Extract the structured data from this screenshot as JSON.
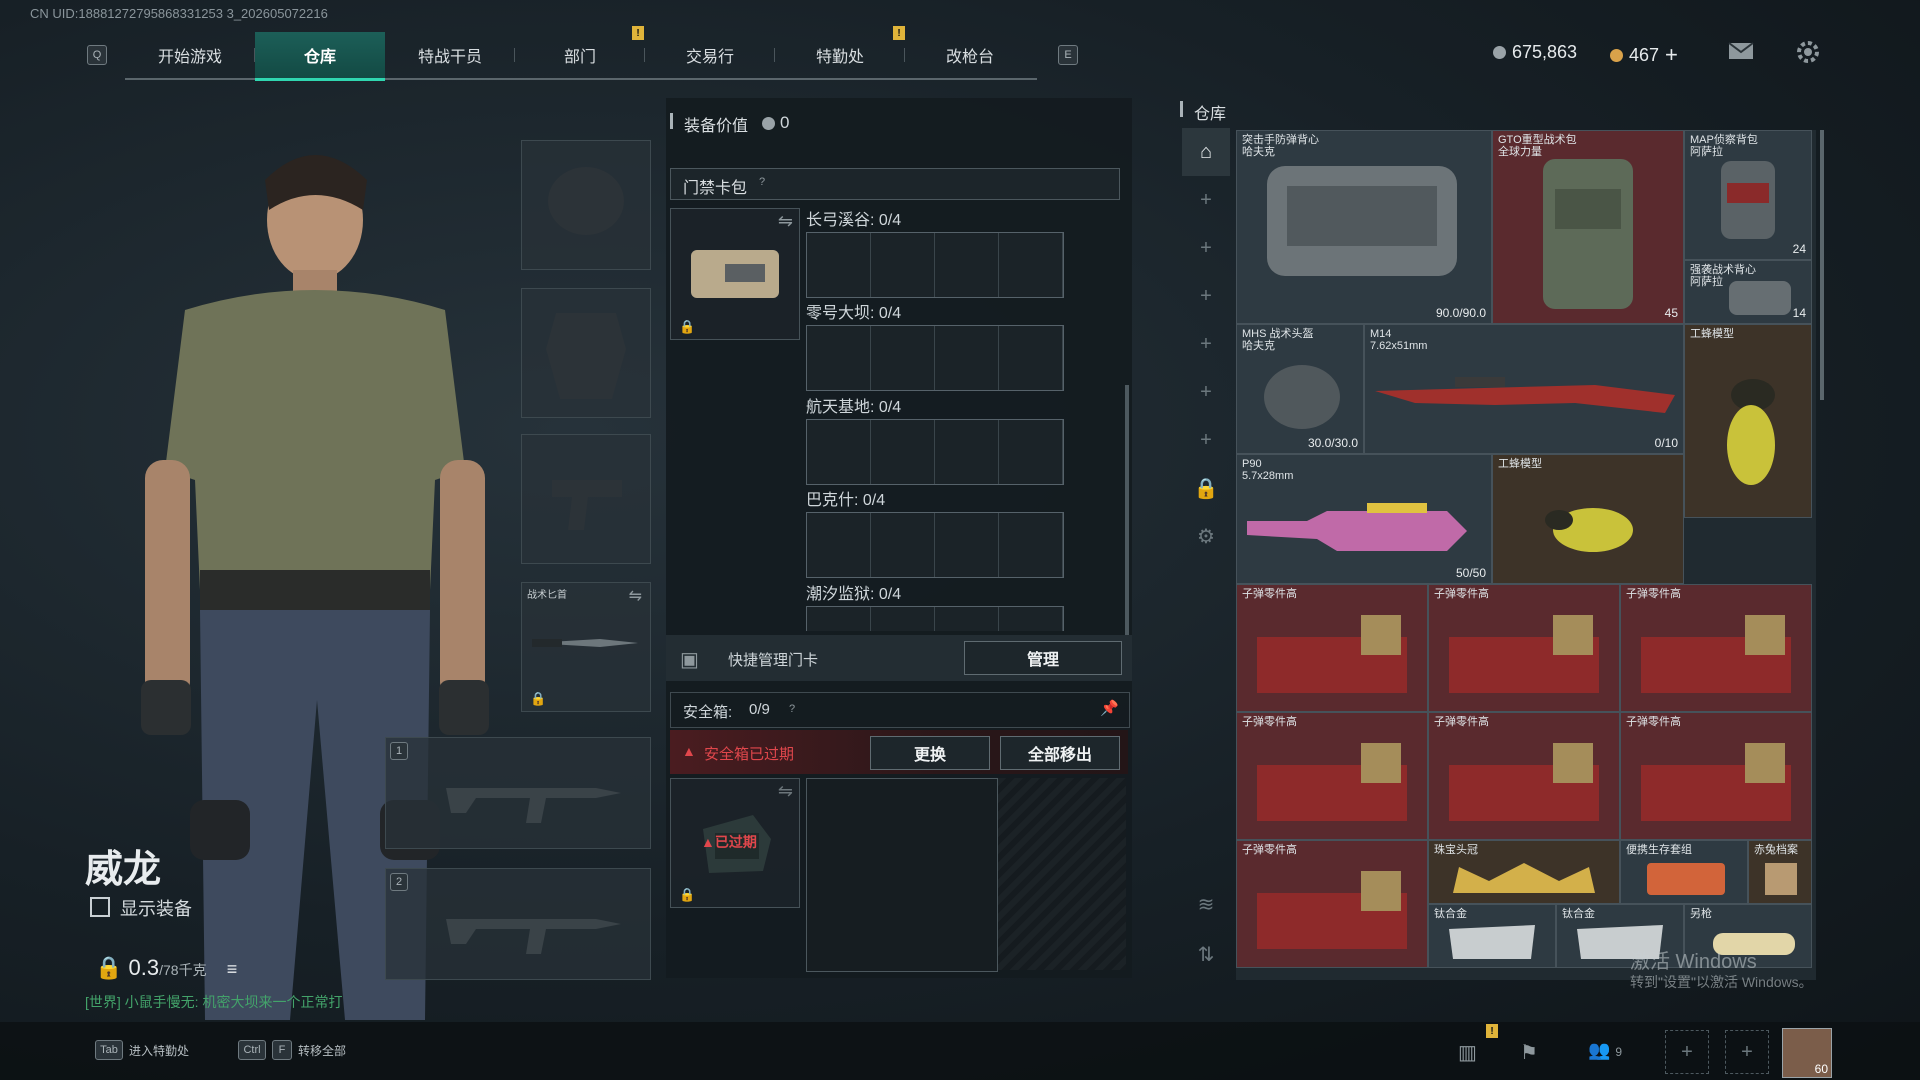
{
  "uid": "CN UID:18881272795868331253 3_202605072216",
  "nav": {
    "left_key": "Q",
    "right_key": "E",
    "tabs": [
      "开始游戏",
      "仓库",
      "特战干员",
      "部门",
      "交易行",
      "特勤处",
      "改枪台"
    ],
    "active_tab": "仓库"
  },
  "currency": {
    "silver": "675,863",
    "gold": "467",
    "add": "+"
  },
  "character": {
    "name": "威龙",
    "show_gear_label": "显示装备",
    "weight_value": "0.3",
    "weight_unit": "/78千克",
    "chat": "[世界] 小鼠手慢无: 机密大坝来一个正常打"
  },
  "equipment": {
    "knife_label": "战术匕首",
    "slot1": "1",
    "slot2": "2"
  },
  "middle": {
    "equip_value_label": "装备价值",
    "equip_value": "0",
    "keycard_bag_label": "门禁卡包",
    "help": "?",
    "maps": [
      "长弓溪谷: 0/4",
      "零号大坝: 0/4",
      "航天基地: 0/4",
      "巴克什: 0/4",
      "潮汐监狱: 0/4"
    ],
    "quick_manage_label": "快捷管理门卡",
    "manage_button": "管理",
    "safebox_label": "安全箱: ",
    "safebox_count": "0/9",
    "safebox_expired": "安全箱已过期",
    "replace_button": "更换",
    "move_all_button": "全部移出",
    "expired_tag": "已过期"
  },
  "stash": {
    "title": "仓库",
    "items": [
      {
        "name": "突击手防弹背心\n哈夫克",
        "count": "90.0/90.0"
      },
      {
        "name": "GTO重型战术包\n全球力量",
        "count": "45"
      },
      {
        "name": "MAP侦察背包\n阿萨拉",
        "count": "24"
      },
      {
        "name": "强袭战术背心\n阿萨拉",
        "count": "14"
      },
      {
        "name": "MHS 战术头盔\n哈夫克",
        "count": "30.0/30.0"
      },
      {
        "name": "M14\n7.62x51mm",
        "count": "0/10"
      },
      {
        "name": "工蜂模型",
        "count": ""
      },
      {
        "name": "P90\n5.7x28mm",
        "count": "50/50"
      },
      {
        "name": "工蜂模型",
        "count": ""
      },
      {
        "name": "子弹零件高",
        "count": ""
      },
      {
        "name": "子弹零件高",
        "count": ""
      },
      {
        "name": "子弹零件高",
        "count": ""
      },
      {
        "name": "子弹零件高",
        "count": ""
      },
      {
        "name": "子弹零件高",
        "count": ""
      },
      {
        "name": "子弹零件高",
        "count": ""
      },
      {
        "name": "子弹零件高",
        "count": ""
      },
      {
        "name": "珠宝头冠",
        "count": ""
      },
      {
        "name": "便携生存套组",
        "count": ""
      },
      {
        "name": "赤兔档案",
        "count": ""
      },
      {
        "name": "钛合金",
        "count": ""
      },
      {
        "name": "钛合金",
        "count": ""
      },
      {
        "name": "另枪",
        "count": ""
      }
    ]
  },
  "bottom": {
    "tab_key": "Tab",
    "enter_special": "进入特勤处",
    "ctrl_key": "Ctrl",
    "f_key": "F",
    "transfer_all": "转移全部",
    "friends_count": "9",
    "level": "60"
  },
  "watermark": {
    "line1": "激活 Windows",
    "line2": "转到\"设置\"以激活 Windows。"
  },
  "colors": {
    "accent": "#30d6b0",
    "danger": "#e0474c",
    "warn": "#e0b43a"
  }
}
